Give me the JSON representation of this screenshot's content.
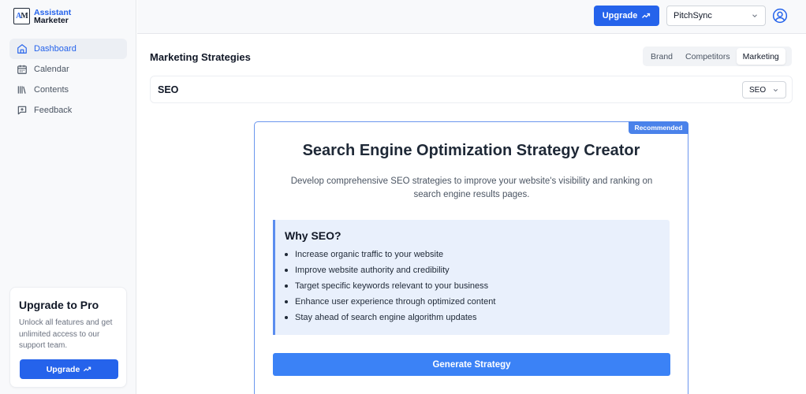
{
  "logo": {
    "line1": "Assistant",
    "line2": "Marketer",
    "mark_a": "A",
    "mark_m": "M"
  },
  "sidebar": {
    "items": [
      {
        "label": "Dashboard",
        "icon": "home-icon",
        "active": true
      },
      {
        "label": "Calendar",
        "icon": "calendar-icon",
        "active": false
      },
      {
        "label": "Contents",
        "icon": "library-icon",
        "active": false
      },
      {
        "label": "Feedback",
        "icon": "feedback-icon",
        "active": false
      }
    ],
    "promo": {
      "title": "Upgrade to Pro",
      "text": "Unlock all features and get unlimited access to our support team.",
      "button": "Upgrade"
    }
  },
  "topbar": {
    "upgrade_label": "Upgrade",
    "project": "PitchSync"
  },
  "main": {
    "title": "Marketing Strategies",
    "tabs": [
      {
        "label": "Brand"
      },
      {
        "label": "Competitors"
      },
      {
        "label": "Marketing",
        "active": true
      }
    ],
    "section_label": "SEO",
    "section_select": "SEO"
  },
  "card": {
    "badge": "Recommended",
    "title": "Search Engine Optimization Strategy Creator",
    "description": "Develop comprehensive SEO strategies to improve your website's visibility and ranking on search engine results pages.",
    "why_title": "Why SEO?",
    "why_items": [
      "Increase organic traffic to your website",
      "Improve website authority and credibility",
      "Target specific keywords relevant to your business",
      "Enhance user experience through optimized content",
      "Stay ahead of search engine algorithm updates"
    ],
    "button": "Generate Strategy"
  },
  "colors": {
    "accent": "#2563eb",
    "card_border": "#6b96ee",
    "why_bg": "#e9f0fc",
    "button": "#3b82f6"
  }
}
